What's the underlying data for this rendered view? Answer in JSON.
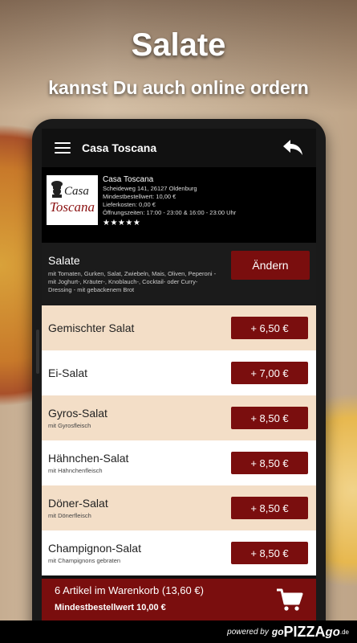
{
  "promo": {
    "headline": "Salate",
    "subline": "kannst Du auch online ordern"
  },
  "appbar": {
    "title": "Casa Toscana"
  },
  "restaurant": {
    "logo_casa": "Casa",
    "logo_toscana": "Toscana",
    "name": "Casa Toscana",
    "address": "Scheideweg 141, 26127 Oldenburg",
    "min_order": "Mindestbestellwert: 10,00 €",
    "delivery": "Lieferkosten: 0,00 €",
    "hours": "Öffnungszeiten: 17:00 - 23:00 & 16:00 - 23:00 Uhr",
    "stars": "★★★★★"
  },
  "category": {
    "title": "Salate",
    "description": "mit Tomaten, Gurken, Salat, Zwiebeln, Mais, Oliven, Peperoni - mit Joghurt-, Kräuter-, Knoblauch-, Cocktail- oder Curry-Dressing - mit gebackenem Brot",
    "change_label": "Ändern"
  },
  "items": [
    {
      "name": "Gemischter Salat",
      "desc": "",
      "price": "+ 6,50 €"
    },
    {
      "name": "Ei-Salat",
      "desc": "",
      "price": "+ 7,00 €"
    },
    {
      "name": "Gyros-Salat",
      "desc": "mit Gyrosfleisch",
      "price": "+ 8,50 €"
    },
    {
      "name": "Hähnchen-Salat",
      "desc": "mit Hähnchenfleisch",
      "price": "+ 8,50 €"
    },
    {
      "name": "Döner-Salat",
      "desc": "mit Dönerfleisch",
      "price": "+ 8,50 €"
    },
    {
      "name": "Champignon-Salat",
      "desc": "mit Champignons gebraten",
      "price": "+ 8,50 €"
    }
  ],
  "cart": {
    "summary": "6 Artikel im Warenkorb (13,60 €)",
    "min_order": "Mindestbestellwert 10,00 €"
  },
  "footer": {
    "powered": "powered by",
    "go": "go",
    "pizza": "PIZZA",
    "go2": "go",
    "de": ".de"
  },
  "colors": {
    "accent": "#7a0e0e",
    "row_alt": "#f3dec7"
  }
}
